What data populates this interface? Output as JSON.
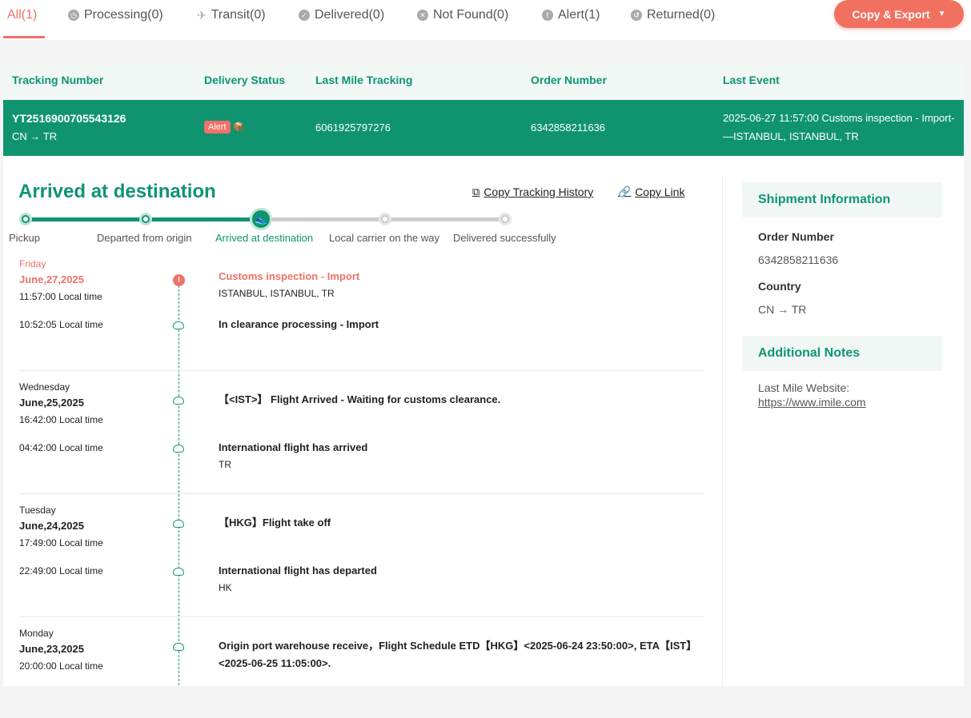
{
  "tabs": [
    {
      "label": "All(1)",
      "icon": "none"
    },
    {
      "label": "Processing(0)",
      "icon": "clock-icon"
    },
    {
      "label": "Transit(0)",
      "icon": "plane-icon"
    },
    {
      "label": "Delivered(0)",
      "icon": "check-icon"
    },
    {
      "label": "Not Found(0)",
      "icon": "x-icon"
    },
    {
      "label": "Alert(1)",
      "icon": "alert-icon"
    },
    {
      "label": "Returned(0)",
      "icon": "return-icon"
    }
  ],
  "copy_export": "Copy & Export",
  "table": {
    "headers": [
      "Tracking Number",
      "Delivery Status",
      "Last Mile Tracking",
      "Order Number",
      "Last Event"
    ],
    "row": {
      "tracking_number": "YT2516900705543126",
      "route": "CN → TR",
      "status": "Alert",
      "last_mile": "6061925797276",
      "order_number": "6342858211636",
      "last_event_line1": "2025-06-27 11:57:00 Customs inspection - Import-",
      "last_event_line2": "—ISTANBUL, ISTANBUL, TR"
    }
  },
  "detail": {
    "status_title": "Arrived at destination",
    "copy_history": "Copy Tracking History",
    "copy_link": "Copy Link",
    "progress_steps": [
      "Pickup",
      "Departed from origin",
      "Arrived at destination",
      "Local carrier on the way",
      "Delivered successfully"
    ],
    "current_step": 2
  },
  "events": {
    "g1": {
      "day": "Friday",
      "date": "June,27,2025",
      "e1": {
        "time": "11:57:00 Local time",
        "title": "Customs inspection - Import",
        "loc": "ISTANBUL, ISTANBUL, TR"
      },
      "e2": {
        "time": "10:52:05 Local time",
        "title": "In clearance processing - Import"
      }
    },
    "g2": {
      "day": "Wednesday",
      "date": "June,25,2025",
      "e1": {
        "time": "16:42:00 Local time",
        "title": "【<IST>】 Flight Arrived - Waiting for customs clearance."
      },
      "e2": {
        "time": "04:42:00 Local time",
        "title": "International flight has arrived",
        "loc": "TR"
      }
    },
    "g3": {
      "day": "Tuesday",
      "date": "June,24,2025",
      "e1": {
        "time": "17:49:00 Local time",
        "title": "【HKG】Flight take off"
      },
      "e2": {
        "time": "22:49:00 Local time",
        "title": "International flight has departed",
        "loc": "HK"
      }
    },
    "g4": {
      "day": "Monday",
      "date": "June,23,2025",
      "e1": {
        "time": "20:00:00 Local time",
        "title": "Origin port warehouse receive，Flight Schedule ETD【HKG】<2025-06-24 23:50:00>, ETA【IST】<2025-06-25 11:05:00>."
      }
    }
  },
  "side": {
    "shipment_head": "Shipment Information",
    "order_label": "Order Number",
    "order_value": "6342858211636",
    "country_label": "Country",
    "country_value": "CN → TR",
    "notes_head": "Additional Notes",
    "website_label": "Last Mile Website:",
    "website_url": "https://www.imile.com"
  },
  "colors": {
    "brand_green": "#109470",
    "alert": "#f07167"
  }
}
